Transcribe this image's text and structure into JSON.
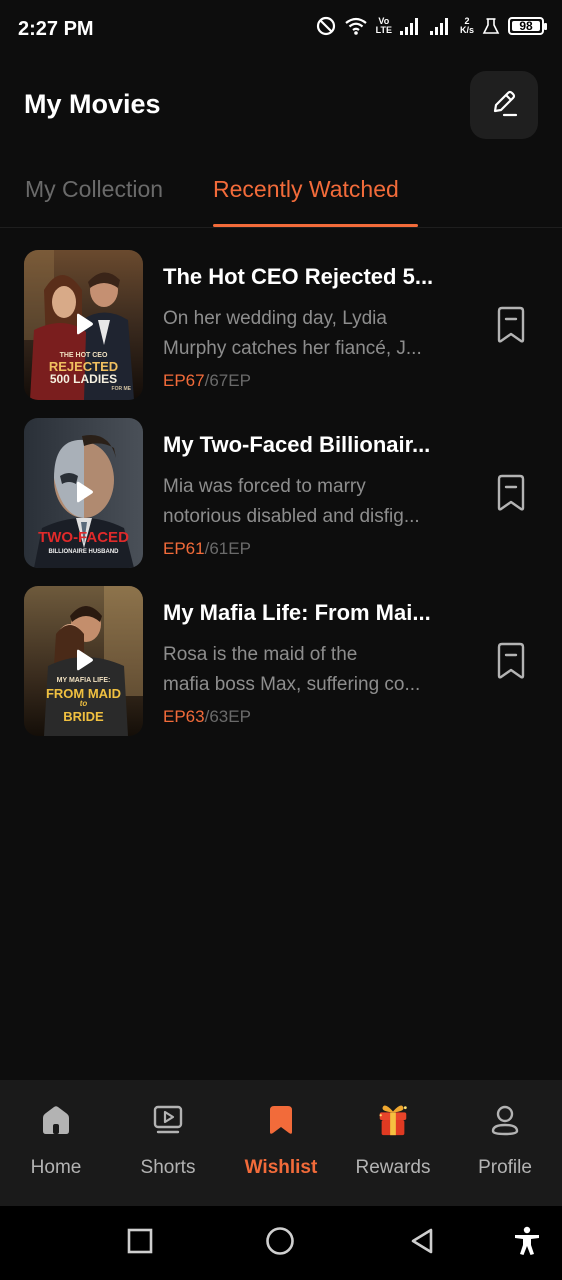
{
  "status_bar": {
    "time": "2:27 PM",
    "network_label_top": "Vo",
    "network_label_bottom": "LTE",
    "speed_value": "2",
    "speed_unit": "K/s",
    "battery": "98"
  },
  "header": {
    "title": "My Movies",
    "edit_icon": "pencil-edit-icon"
  },
  "tabs": [
    {
      "label": "My Collection",
      "active": false
    },
    {
      "label": "Recently Watched",
      "active": true
    }
  ],
  "items": [
    {
      "title": "The Hot CEO Rejected 5...",
      "desc_line1": "On her wedding day, Lydia",
      "desc_line2": "Murphy catches her fiancé, J...",
      "ep_current": "EP67",
      "ep_total": "/67EP",
      "poster_small": "THE HOT CEO",
      "poster_big1": "REJECTED",
      "poster_big2": "500 LADIES",
      "poster_tiny": "FOR ME"
    },
    {
      "title": "My Two-Faced Billionair...",
      "desc_line1": "Mia was forced to marry",
      "desc_line2": "notorious disabled and disfig...",
      "ep_current": "EP61",
      "ep_total": "/61EP",
      "poster_big1": "TWO-FACED",
      "poster_small": "BILLIONAIRE HUSBAND"
    },
    {
      "title": "My Mafia Life: From Mai...",
      "desc_line1": "Rosa is the maid of the",
      "desc_line2": "mafia boss Max, suffering co...",
      "ep_current": "EP63",
      "ep_total": "/63EP",
      "poster_small": "MY MAFIA LIFE:",
      "poster_big1": "FROM MAID",
      "poster_tiny": "to",
      "poster_big2": "BRIDE"
    }
  ],
  "bottom_nav": [
    {
      "label": "Home",
      "icon": "home-icon",
      "active": false
    },
    {
      "label": "Shorts",
      "icon": "play-screen-icon",
      "active": false
    },
    {
      "label": "Wishlist",
      "icon": "bookmark-icon",
      "active": true
    },
    {
      "label": "Rewards",
      "icon": "gift-icon",
      "active": false
    },
    {
      "label": "Profile",
      "icon": "person-icon",
      "active": false
    }
  ],
  "colors": {
    "accent": "#f26b3a",
    "background": "#0d0d0d",
    "nav_background": "#1a1a1a",
    "muted_text": "#8d8d8d"
  }
}
